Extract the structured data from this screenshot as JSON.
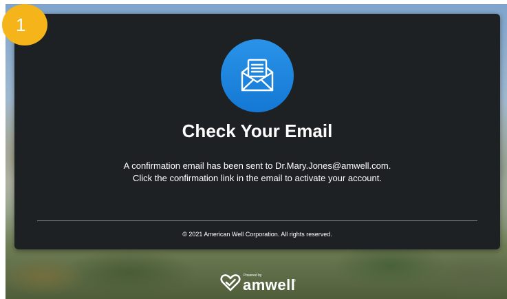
{
  "step": {
    "number": "1",
    "color": "#f5b51a"
  },
  "dialog": {
    "icon": "envelope-open-icon",
    "accent": "#1e86e0",
    "background": "#1e2124",
    "title": "Check Your Email",
    "message": "A confirmation email has been sent to Dr.Mary.Jones@amwell.com. Click the confirmation link in the email to activate your account.",
    "footer": "© 2021 American Well Corporation. All rights reserved."
  },
  "branding": {
    "powered_by": "Powered by",
    "logo_text": "amwell",
    "trademark": "®",
    "logo_icon": "amwell-heart-check-icon"
  }
}
